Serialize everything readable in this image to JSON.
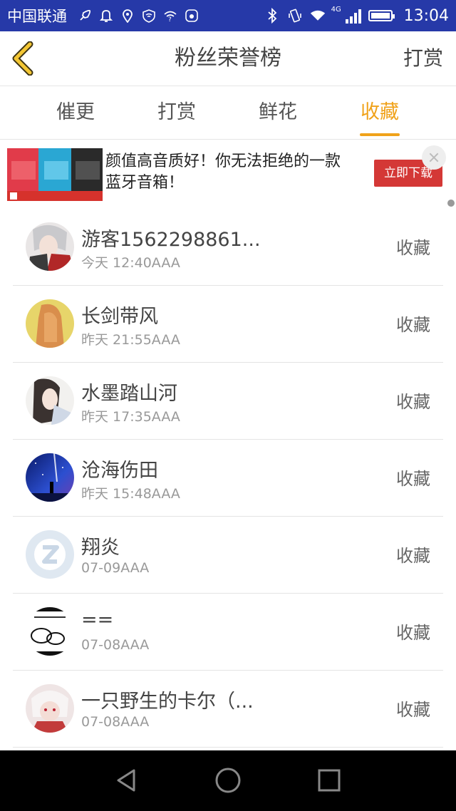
{
  "status_bar": {
    "carrier": "中国联通",
    "network": "4G",
    "time": "13:04"
  },
  "header": {
    "title": "粉丝荣誉榜",
    "right_label": "打赏"
  },
  "tabs": [
    {
      "label": "催更",
      "active": false
    },
    {
      "label": "打赏",
      "active": false
    },
    {
      "label": "鲜花",
      "active": false
    },
    {
      "label": "收藏",
      "active": true
    }
  ],
  "ad": {
    "text": "颜值高音质好！你无法拒绝的一款蓝牙音箱！",
    "button": "立即下载"
  },
  "list": [
    {
      "name": "游客1562298861...",
      "time": "今天 12:40AAA",
      "action": "收藏",
      "avatar": "avatar-gray-hair"
    },
    {
      "name": "长剑带风",
      "time": "昨天 21:55AAA",
      "action": "收藏",
      "avatar": "avatar-long-hair"
    },
    {
      "name": "水墨踏山河",
      "time": "昨天 17:35AAA",
      "action": "收藏",
      "avatar": "avatar-ink-portrait"
    },
    {
      "name": "沧海伤田",
      "time": "昨天 15:48AAA",
      "action": "收藏",
      "avatar": "avatar-night-sky"
    },
    {
      "name": "翔炎",
      "time": "07-09AAA",
      "action": "收藏",
      "avatar": "avatar-default"
    },
    {
      "name": "==",
      "time": "07-08AAA",
      "action": "收藏",
      "avatar": "avatar-sketch"
    },
    {
      "name": "一只野生的卡尔（...",
      "time": "07-08AAA",
      "action": "收藏",
      "avatar": "avatar-white-hair"
    }
  ],
  "colors": {
    "status_bar": "#2639a8",
    "accent": "#f0a21a",
    "ad_button": "#d43836"
  }
}
